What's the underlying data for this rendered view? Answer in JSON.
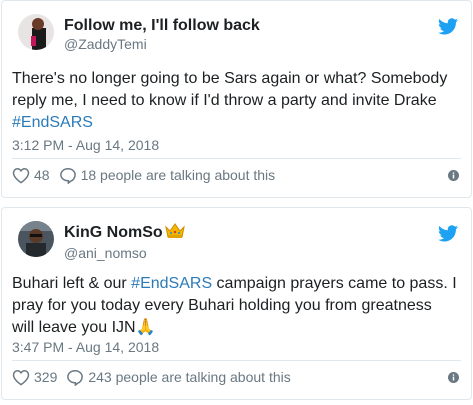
{
  "colors": {
    "link": "#2b7bb9",
    "muted": "#697882",
    "twitter_blue": "#1da1f2",
    "text": "#1c2022"
  },
  "tweets": [
    {
      "display_name": "Follow me, I'll follow back",
      "handle": "@ZaddyTemi",
      "body_before": "There's no longer going to be Sars again or what? Somebody reply me, I need to know if I'd throw a party and invite Drake ",
      "hashtag": "#EndSARS",
      "body_after": "",
      "timestamp": "3:12 PM - Aug 14, 2018",
      "likes": "48",
      "talking": "18 people are talking about this",
      "icons": {
        "like": "heart-icon",
        "reply": "speech-bubble-icon",
        "info": "info-icon",
        "brand": "twitter-bird-icon"
      }
    },
    {
      "display_name": "KinG NomSo",
      "handle": "@ani_nomso",
      "body_before": "Buhari left & our ",
      "hashtag": "#EndSARS",
      "body_after": " campaign prayers came to pass. I pray for you today every Buhari holding you from greatness will leave you IJN🙏",
      "timestamp": "3:47 PM - Aug 14, 2018",
      "likes": "329",
      "talking": "243 people are talking about this",
      "icons": {
        "like": "heart-icon",
        "reply": "speech-bubble-icon",
        "info": "info-icon",
        "brand": "twitter-bird-icon",
        "name_emoji": "crown-icon"
      }
    }
  ]
}
